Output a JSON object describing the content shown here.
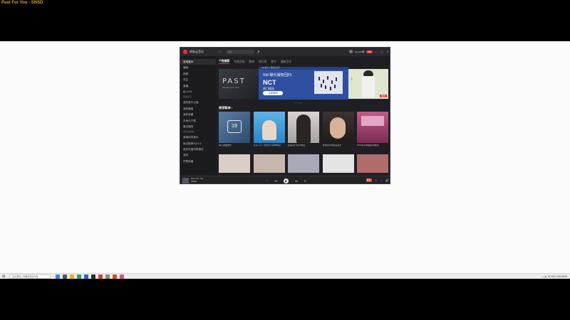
{
  "video": {
    "title": "Past For You - SNSD"
  },
  "app": {
    "name": "网易云音乐",
    "search_placeholder": "搜索",
    "back_arrows": "‹ ›",
    "user": {
      "name": "Cecuz001",
      "badge": "VIP"
    },
    "window_controls": [
      "⚙",
      "✉",
      "—",
      "▢",
      "✕"
    ]
  },
  "sidebar": {
    "items": [
      {
        "label": "发现音乐",
        "active": true
      },
      {
        "label": "播客"
      },
      {
        "label": "视频"
      },
      {
        "label": "关注"
      },
      {
        "label": "直播"
      },
      {
        "label": "私人FM"
      }
    ],
    "my_music_head": "我的音乐",
    "my_music": [
      "我的音乐云盘",
      "我的播客",
      "我的收藏",
      "本地与下载",
      "最近播放"
    ],
    "playlists_head": "创建的歌单",
    "playlists": [
      "我喜欢的音乐",
      "每日推荐2021.5",
      "我的年度听歌报告",
      "我的",
      "好歌收藏"
    ]
  },
  "main": {
    "tabs": [
      {
        "label": "个性推荐",
        "active": true
      },
      {
        "label": "专属定制"
      },
      {
        "label": "歌单"
      },
      {
        "label": "排行榜"
      },
      {
        "label": "歌手"
      },
      {
        "label": "最新音乐"
      }
    ],
    "banner": {
      "left_text": "PAST",
      "left_sub": "KWON JUN YEOL",
      "strip": "SM 娱乐 × 网易云音乐",
      "title": "SM 娱乐版权回归",
      "headline": "NCT",
      "subtitle": "热门精选",
      "button": "立即收听",
      "right_tag": "独家"
    },
    "section_title": "推荐歌单 ›",
    "cards": [
      {
        "caption": "每日歌曲推荐",
        "calendar": "19"
      },
      {
        "caption": "日系小众 | 治愈女声歌单精选"
      },
      {
        "caption": "欧美流行女声精选"
      },
      {
        "caption": "那些好听的欧美男声"
      },
      {
        "caption": "2021韩流歌曲最新精选"
      }
    ]
  },
  "player": {
    "song": "Past For You",
    "artist": "SNSD",
    "progress": 0.08,
    "controls": [
      "♡",
      "⏮",
      "▶",
      "⏭",
      "↻"
    ],
    "quality": "极高",
    "right_icons": [
      "≡",
      "♪",
      "🔊"
    ]
  },
  "taskbar": {
    "search_text": "在这里输入你要搜索的内容",
    "tray_text": "∧ 🔊 中  19:01  2021/5/19"
  }
}
